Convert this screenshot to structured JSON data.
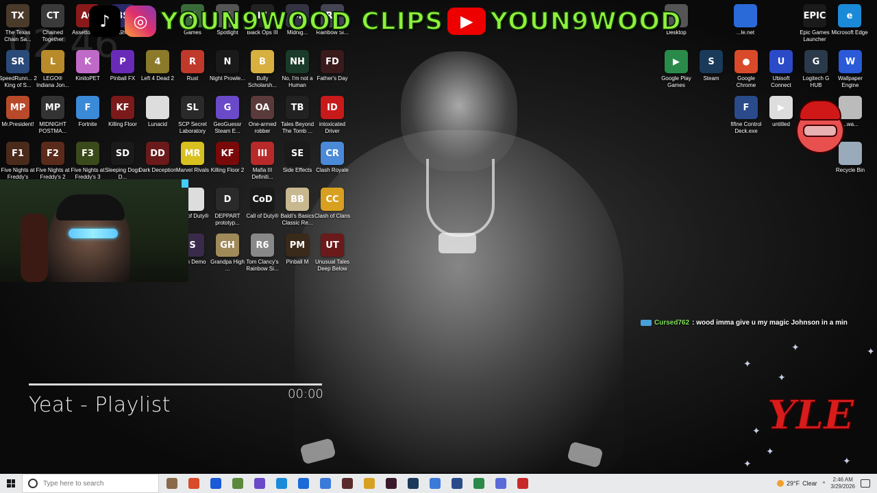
{
  "banner": {
    "tiktok_icon": "tiktok-icon",
    "instagram_icon": "instagram-icon",
    "clips_text": "YOUN9WOOD CLIPS",
    "youtube_icon": "youtube-icon",
    "channel_text": "YOUN9WOOD"
  },
  "ghost_clock": "02:46",
  "desktop_icons_left": [
    {
      "label": "The Texas Chain Sa...",
      "color": "#4a3a2a",
      "glyph": "TX"
    },
    {
      "label": "Chained Together",
      "color": "#3a3a3a",
      "glyph": "CT"
    },
    {
      "label": "Assetto Co...",
      "color": "#8a1a1a",
      "glyph": "AC"
    },
    {
      "label": "Beat Shortcut",
      "color": "#2a2a6a",
      "glyph": "BS"
    },
    {
      "label": "Games",
      "color": "#3a6a3a",
      "glyph": "G"
    },
    {
      "label": "Spotlight",
      "color": "#555",
      "glyph": "S"
    },
    {
      "label": "Black Ops III",
      "color": "#222",
      "glyph": "III"
    },
    {
      "label": "Midnig...",
      "color": "#334",
      "glyph": "M"
    },
    {
      "label": "Rainbow Si...",
      "color": "#445",
      "glyph": "R6"
    },
    {
      "label": "SpeedRunn... 2 King of S...",
      "color": "#2a4a7a",
      "glyph": "SR"
    },
    {
      "label": "LEGO® Indiana Jon...",
      "color": "#b88a2a",
      "glyph": "L"
    },
    {
      "label": "KinitoPET",
      "color": "#c06ac8",
      "glyph": "K"
    },
    {
      "label": "Pinball FX",
      "color": "#6a2ab8",
      "glyph": "P"
    },
    {
      "label": "Left 4 Dead 2",
      "color": "#8a7a2a",
      "glyph": "4"
    },
    {
      "label": "Rust",
      "color": "#c0392b",
      "glyph": "R"
    },
    {
      "label": "Night Prowle...",
      "color": "#1a1a1a",
      "glyph": "N"
    },
    {
      "label": "Bully Scholarsh...",
      "color": "#d8b040",
      "glyph": "B"
    },
    {
      "label": "No, I'm not a Human",
      "color": "#1a3a2a",
      "glyph": "NH"
    },
    {
      "label": "Father's Day",
      "color": "#3a1a1a",
      "glyph": "FD"
    },
    {
      "label": "Mr.President!",
      "color": "#b84a2a",
      "glyph": "MP"
    },
    {
      "label": "MIDNIGHT POSTMA...",
      "color": "#333",
      "glyph": "MP"
    },
    {
      "label": "Fortnite",
      "color": "#3a8ad8",
      "glyph": "F"
    },
    {
      "label": "Killing Floor",
      "color": "#7a1a1a",
      "glyph": "KF"
    },
    {
      "label": "Lunacid",
      "color": "#ddd",
      "glyph": ""
    },
    {
      "label": "SCP Secret Laboratory",
      "color": "#2a2a2a",
      "glyph": "SL"
    },
    {
      "label": "GeoGuessr Steam E...",
      "color": "#6a4ac8",
      "glyph": "G"
    },
    {
      "label": "One-armed robber",
      "color": "#5a3a3a",
      "glyph": "OA"
    },
    {
      "label": "Tales Beyond The Tomb ...",
      "color": "#222",
      "glyph": "TB"
    },
    {
      "label": "intoxicated Driver",
      "color": "#c81a1a",
      "glyph": "ID"
    },
    {
      "label": "Five Nights at Freddy's",
      "color": "#4a2a1a",
      "glyph": "F1"
    },
    {
      "label": "Five Nights at Freddy's 2",
      "color": "#5a2a1a",
      "glyph": "F2"
    },
    {
      "label": "Five Nights at Freddy's 3",
      "color": "#3a4a1a",
      "glyph": "F3"
    },
    {
      "label": "Sleeping Dogs D...",
      "color": "#1a1a1a",
      "glyph": "SD"
    },
    {
      "label": "Dark Deception",
      "color": "#6a1a1a",
      "glyph": "DD"
    },
    {
      "label": "Marvel Rivals",
      "color": "#d8c020",
      "glyph": "MR"
    },
    {
      "label": "Killing Floor 2",
      "color": "#7a0a0a",
      "glyph": "KF"
    },
    {
      "label": "Mafia III Definiti...",
      "color": "#b82a2a",
      "glyph": "III"
    },
    {
      "label": "Side Effects",
      "color": "#1a1a1a",
      "glyph": "SE"
    },
    {
      "label": "Clash Royale",
      "color": "#4a8ad8",
      "glyph": "CR"
    },
    {
      "label": "Call of Duty®",
      "color": "#ddd",
      "glyph": ""
    },
    {
      "label": "DEPPART prototyp...",
      "color": "#2a2a2a",
      "glyph": "D"
    },
    {
      "label": "Call of Duty®",
      "color": "#1a1a1a",
      "glyph": "CoD"
    },
    {
      "label": "Baldi's Basics Classic Re...",
      "color": "#c8b890",
      "glyph": "BB"
    },
    {
      "label": "Clash of Clans",
      "color": "#d8a020",
      "glyph": "CC"
    },
    {
      "label": "Skin Demo",
      "color": "#3a2a4a",
      "glyph": "S"
    },
    {
      "label": "Grandpa High ...",
      "color": "#a08a5a",
      "glyph": "GH"
    },
    {
      "label": "Tom Clancy's Rainbow Si...",
      "color": "#888",
      "glyph": "R6"
    },
    {
      "label": "Pinball M",
      "color": "#3a2a1a",
      "glyph": "PM"
    },
    {
      "label": "Unusual Tales Deep Below",
      "color": "#6a1a1a",
      "glyph": "UT"
    }
  ],
  "desktop_icons_right": [
    {
      "label": "Desktop",
      "color": "#555",
      "glyph": ""
    },
    {
      "label": "...le.net",
      "color": "#2a6ad8",
      "glyph": ""
    },
    {
      "label": "Epic Games Launcher",
      "color": "#1a1a1a",
      "glyph": "EPIC"
    },
    {
      "label": "Microsoft Edge",
      "color": "#1a8ad8",
      "glyph": "e"
    },
    {
      "label": "Google Play Games",
      "color": "#2a8a4a",
      "glyph": "▶"
    },
    {
      "label": "Steam",
      "color": "#1a3a5a",
      "glyph": "S"
    },
    {
      "label": "Google Chrome",
      "color": "#d84a2a",
      "glyph": "●"
    },
    {
      "label": "Ubisoft Connect",
      "color": "#2a4ac8",
      "glyph": "U"
    },
    {
      "label": "Logitech G HUB",
      "color": "#2a3a4a",
      "glyph": "G"
    },
    {
      "label": "Wallpaper Engine",
      "color": "#2a5ad8",
      "glyph": "W"
    },
    {
      "label": "fifine Control Deck.exe",
      "color": "#2a4a8a",
      "glyph": "F"
    },
    {
      "label": "untitled",
      "color": "#ddd",
      "glyph": "▶"
    },
    {
      "label": "...wa...",
      "color": "#bbb",
      "glyph": ""
    },
    {
      "label": "Recycle Bin",
      "color": "#9ab",
      "glyph": ""
    }
  ],
  "music": {
    "time": "00:00",
    "title": "Yeat - Playlist",
    "progress": 0
  },
  "chat": {
    "user": "Cursed762",
    "message": ": wood imma give u my magic Johnson in a min"
  },
  "logo": "YLE",
  "taskbar": {
    "search_placeholder": "Type here to search",
    "apps": [
      {
        "name": "file-app",
        "color": "#8a6a4a"
      },
      {
        "name": "chrome-app",
        "color": "#d84a2a"
      },
      {
        "name": "facebook-app",
        "color": "#1a5ad8"
      },
      {
        "name": "minecraft-app",
        "color": "#5a8a3a"
      },
      {
        "name": "copilot-app",
        "color": "#6a4ac8"
      },
      {
        "name": "edge-app",
        "color": "#1a8ad8"
      },
      {
        "name": "store-app",
        "color": "#1a6ad8"
      },
      {
        "name": "mail-app",
        "color": "#3a7ad8"
      },
      {
        "name": "roblox-app",
        "color": "#5a2a2a"
      },
      {
        "name": "explorer-app",
        "color": "#d8a020"
      },
      {
        "name": "obs-app",
        "color": "#3a1a2a"
      },
      {
        "name": "steam-app",
        "color": "#1a3a5a"
      },
      {
        "name": "media-app",
        "color": "#3a7ad8"
      },
      {
        "name": "fifine-app",
        "color": "#2a4a8a"
      },
      {
        "name": "xbox-app",
        "color": "#2a8a4a"
      },
      {
        "name": "discord-app",
        "color": "#5a6ad8"
      },
      {
        "name": "r6-app",
        "color": "#c82a2a"
      }
    ],
    "weather_temp": "29°F",
    "weather_desc": "Clear",
    "time": "2:46 AM",
    "date": "3/29/2026"
  }
}
